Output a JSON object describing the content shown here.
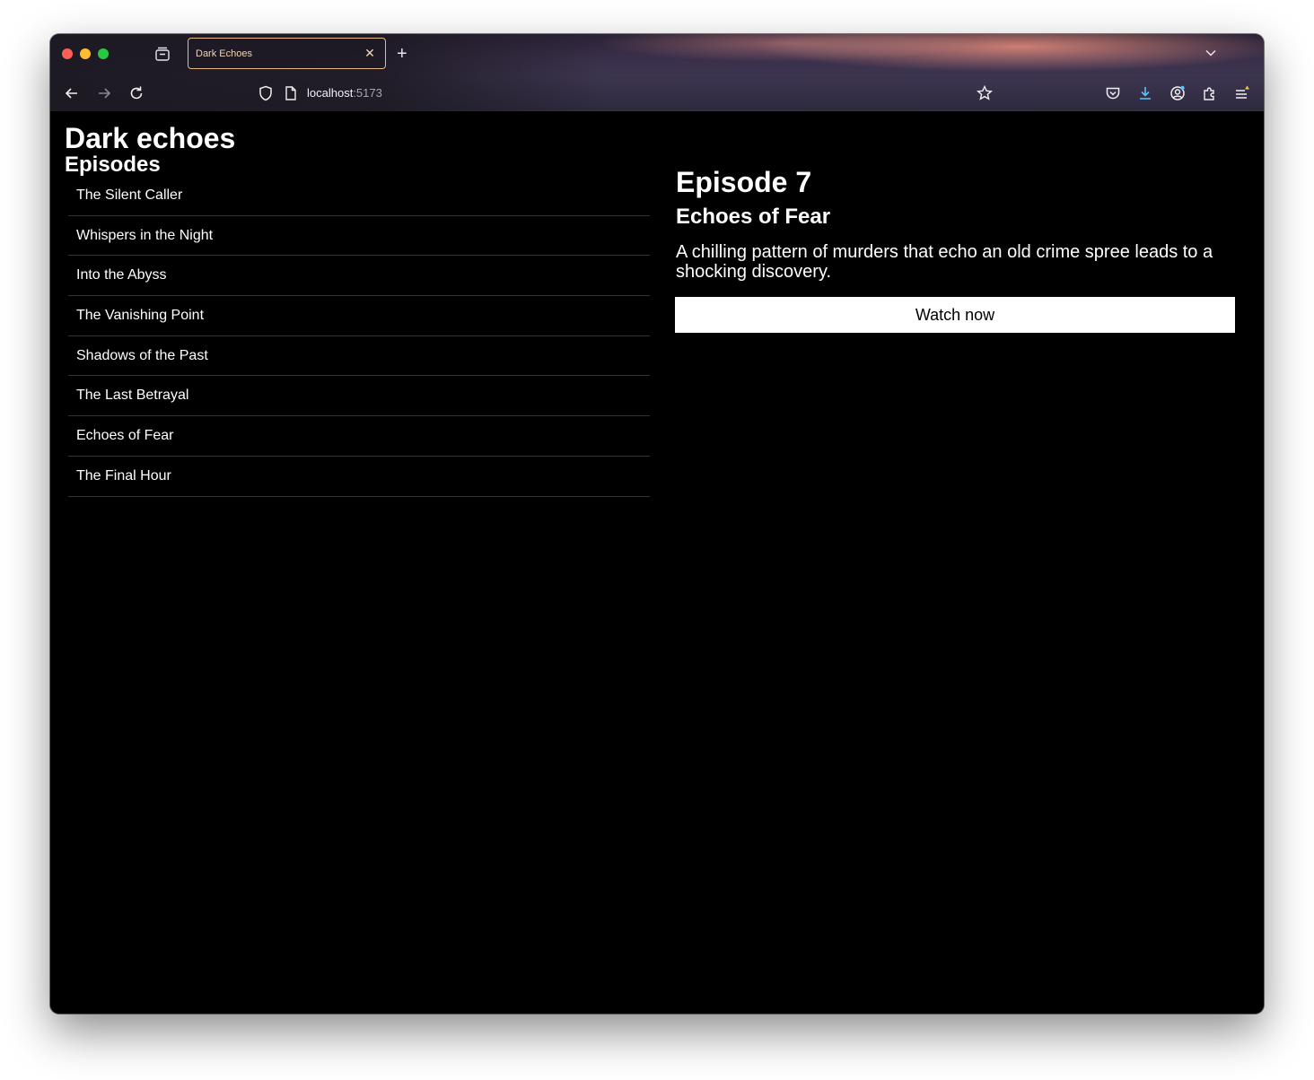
{
  "browser": {
    "tab_title": "Dark Echoes",
    "tab_close": "✕",
    "new_tab": "+",
    "url_host": "localhost",
    "url_port": ":5173"
  },
  "page": {
    "site_title": "Dark echoes",
    "episodes_heading": "Episodes",
    "episodes": [
      "The Silent Caller",
      "Whispers in the Night",
      "Into the Abyss",
      "The Vanishing Point",
      "Shadows of the Past",
      "The Last Betrayal",
      "Echoes of Fear",
      "The Final Hour"
    ],
    "detail": {
      "episode_number": "Episode 7",
      "episode_title": "Echoes of Fear",
      "description": "A chilling pattern of murders that echo an old crime spree leads to a shocking discovery.",
      "watch_label": "Watch now"
    }
  },
  "icons": {
    "back": "arrow-left-icon",
    "forward": "arrow-right-icon",
    "reload": "reload-icon",
    "shield": "shield-icon",
    "page": "page-icon",
    "bookmark": "star-icon",
    "pocket": "pocket-icon",
    "downloads": "download-icon",
    "account": "account-icon",
    "extensions": "puzzle-icon",
    "menu": "menu-icon"
  },
  "colors": {
    "tab_border": "#e7b889",
    "page_background": "#000000",
    "button_background": "#ffffff"
  }
}
